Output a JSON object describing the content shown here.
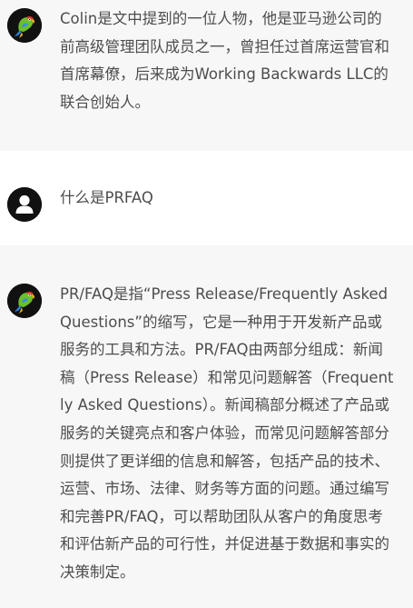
{
  "conversation": [
    {
      "role": "assistant",
      "avatar": "parrot-icon",
      "text": "Colin是文中提到的一位人物，他是亚马逊公司的前高级管理团队成员之一，曾担任过首席运营官和首席幕僚，后来成为Working Backwards LLC的联合创始人。"
    },
    {
      "role": "user",
      "avatar": "user-icon",
      "text": "什么是PRFAQ"
    },
    {
      "role": "assistant",
      "avatar": "parrot-icon",
      "text": "PR/FAQ是指“Press Release/Frequently Asked Questions”的缩写，它是一种用于开发新产品或服务的工具和方法。PR/FAQ由两部分组成：新闻稿（Press Release）和常见问题解答（Frequently Asked Questions）。新闻稿部分概述了产品或服务的关键亮点和客户体验，而常见问题解答部分则提供了更详细的信息和解答，包括产品的技术、运营、市场、法律、财务等方面的问题。通过编写和完善PR/FAQ，可以帮助团队从客户的角度思考和评估新产品的可行性，并促进基于数据和事实的决策制定。"
    }
  ],
  "colors": {
    "assistant_bg": "#f7f7f8",
    "user_bg": "#ffffff",
    "text": "#4d4d4d",
    "avatar_bg": "#111111"
  }
}
